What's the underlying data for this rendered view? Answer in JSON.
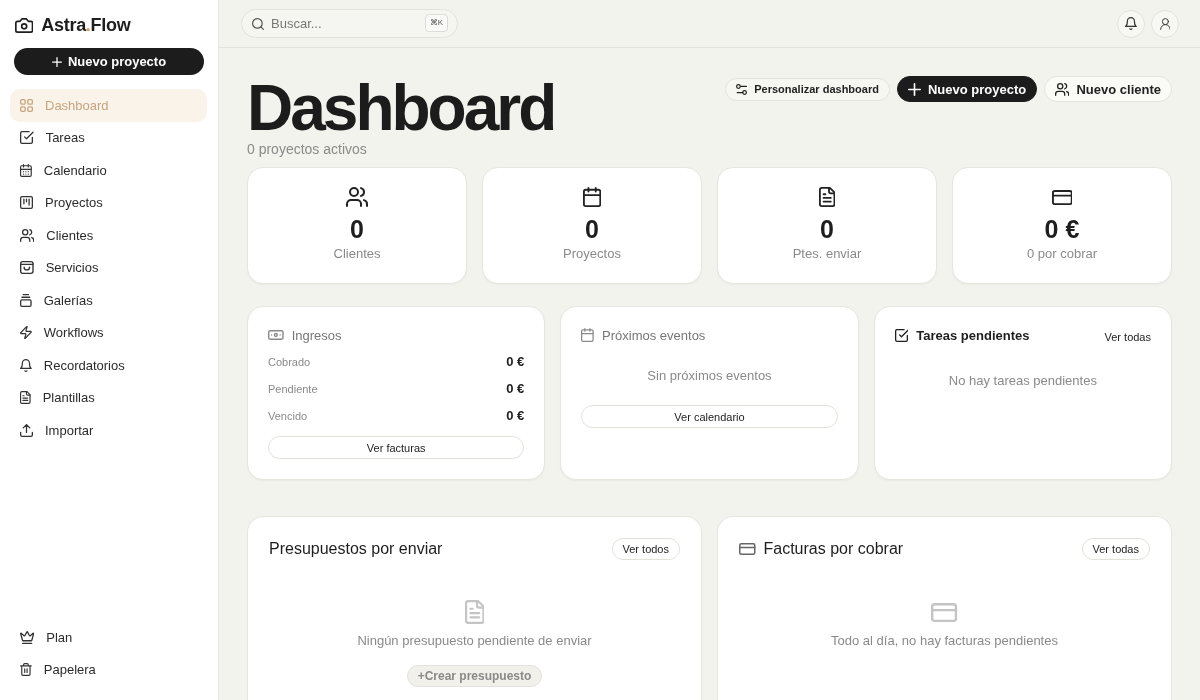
{
  "sidebar": {
    "logo": {
      "before": "Astra",
      "accent": ".",
      "after": "Flow"
    },
    "new_button": "Nuevo proyecto",
    "nav": [
      {
        "label": "Dashboard",
        "selected": true
      },
      {
        "label": "Tareas",
        "selected": false
      },
      {
        "label": "Calendario",
        "selected": false
      },
      {
        "label": "Proyectos",
        "selected": false
      },
      {
        "label": "Clientes",
        "selected": false
      },
      {
        "label": "Servicios",
        "selected": false
      },
      {
        "label": "Galerías",
        "selected": false
      },
      {
        "label": "Workflows",
        "selected": false
      },
      {
        "label": "Recordatorios",
        "selected": false
      },
      {
        "label": "Plantillas",
        "selected": false
      },
      {
        "label": "Importar",
        "selected": false
      }
    ],
    "footer_nav": [
      {
        "label": "Plan",
        "selected": false
      },
      {
        "label": "Papelera",
        "selected": false
      }
    ]
  },
  "topbar": {
    "search": {
      "placeholder": "Buscar...",
      "shortcut": "⌘K"
    }
  },
  "header": {
    "title": "Dashboard",
    "subtitle": "0 proyectos activos",
    "actions": [
      {
        "label": "Personalizar dashboard",
        "kind": "secondary"
      },
      {
        "label": "Nuevo proyecto",
        "kind": "primary"
      },
      {
        "label": "Nuevo cliente",
        "kind": "outline"
      }
    ]
  },
  "stats": [
    {
      "value": "0",
      "label": "Clientes"
    },
    {
      "value": "0",
      "label": "Proyectos"
    },
    {
      "value": "0",
      "label": "Ptes. enviar"
    },
    {
      "value": "0 €",
      "label": "0 por cobrar"
    }
  ],
  "income": {
    "title": "Ingresos",
    "rows": [
      {
        "label": "Cobrado",
        "value": "0 €"
      },
      {
        "label": "Pendiente",
        "value": "0 €"
      },
      {
        "label": "Vencido",
        "value": "0 €"
      }
    ],
    "button": "Ver facturas"
  },
  "events": {
    "title": "Próximos eventos",
    "empty": "Sin próximos eventos",
    "button": "Ver calendario"
  },
  "tasks": {
    "title": "Tareas pendientes",
    "link": "Ver todas",
    "empty": "No hay tareas pendientes"
  },
  "quotes": {
    "title": "Presupuestos por enviar",
    "button": "Ver todos",
    "empty": "Ningún presupuesto pendiente de enviar",
    "action": "+Crear presupuesto"
  },
  "invoices": {
    "title": "Facturas por cobrar",
    "button": "Ver todas",
    "empty": "Todo al día, no hay facturas pendientes"
  }
}
